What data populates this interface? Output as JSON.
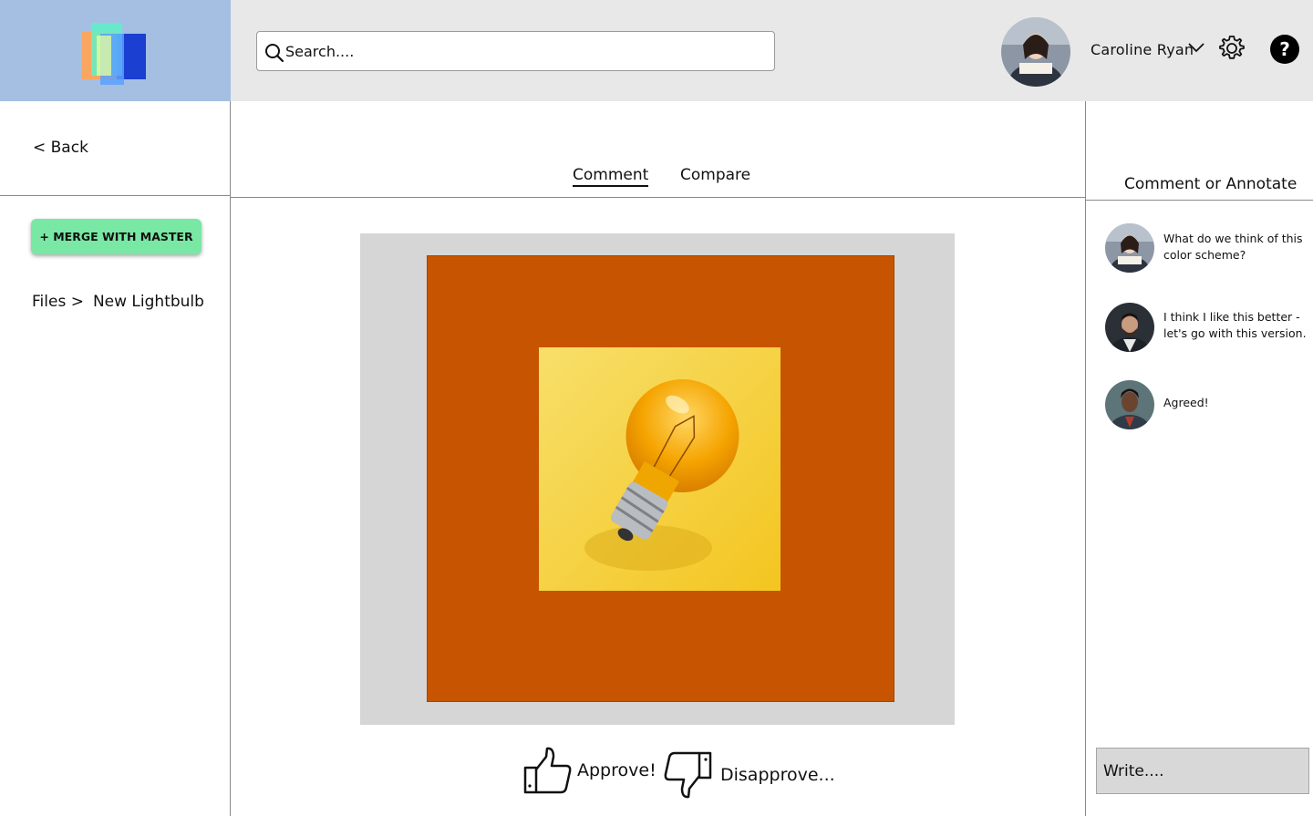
{
  "header": {
    "search_placeholder": "Search....",
    "user_name": "Caroline Ryan"
  },
  "sidebar": {
    "back_label": "< Back",
    "merge_button": "+ MERGE WITH MASTER",
    "breadcrumb": {
      "root": "Files >",
      "current": "New Lightbulb"
    }
  },
  "tabs": [
    {
      "label": "Comment",
      "active": true
    },
    {
      "label": "Compare",
      "active": false
    }
  ],
  "canvas": {
    "background_color": "#c75400"
  },
  "actions": {
    "approve_label": "Approve!",
    "disapprove_label": "Disapprove..."
  },
  "annotations": {
    "title": "Comment or Annotate",
    "comments": [
      {
        "text": "What do we think of this color scheme?"
      },
      {
        "text": "I think I like this better - let's go with this version."
      },
      {
        "text": "Agreed!"
      }
    ],
    "write_placeholder": "Write...."
  }
}
